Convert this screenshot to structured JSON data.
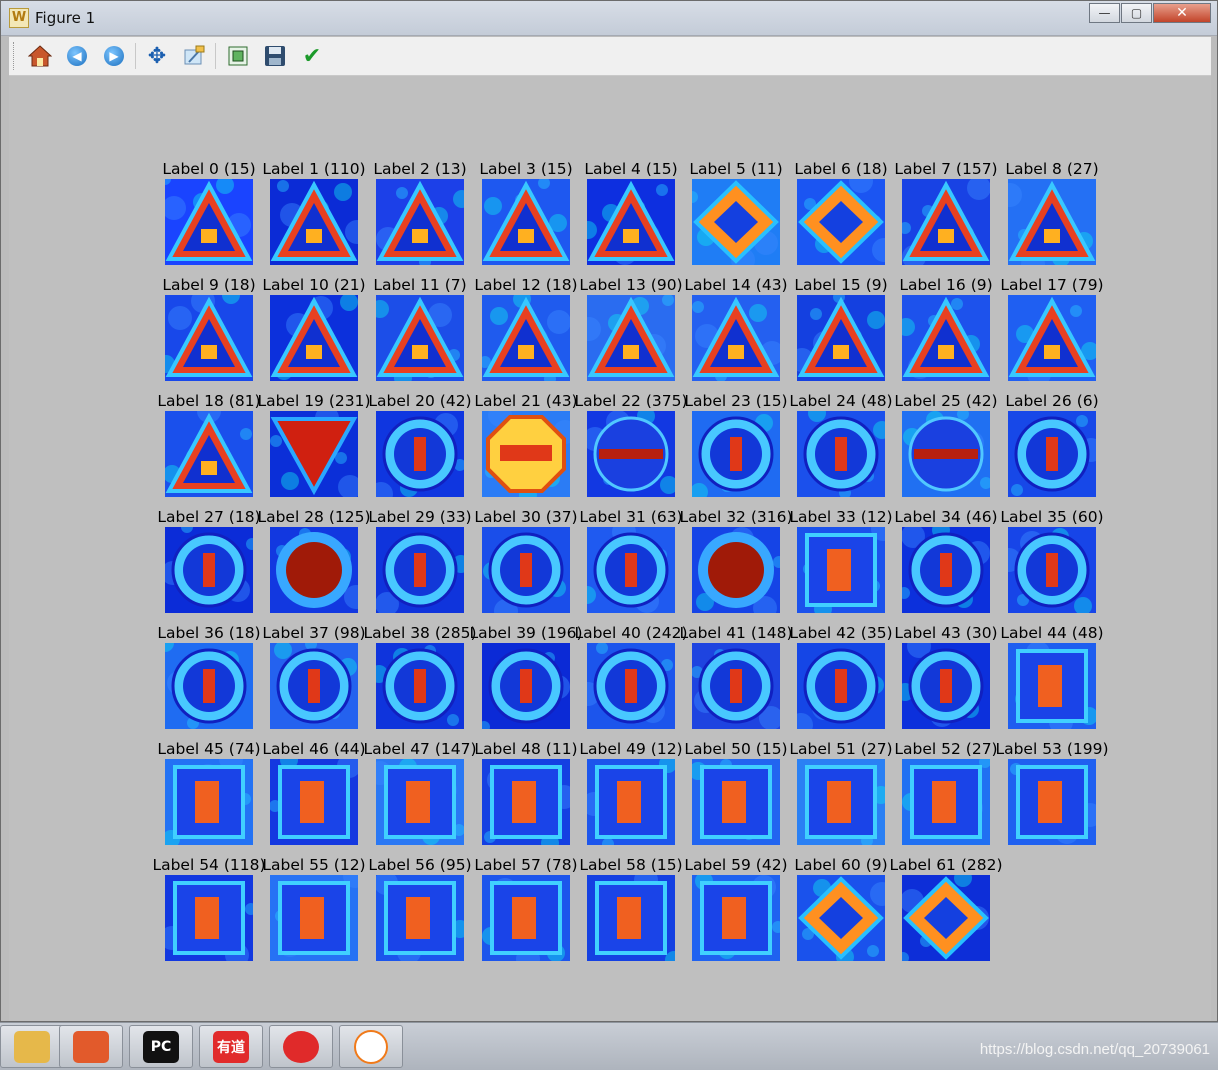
{
  "window": {
    "title": "Figure 1",
    "app_icon_glyph": "W",
    "minimize_glyph": "—",
    "maximize_glyph": "▢",
    "close_glyph": "✕"
  },
  "toolbar": {
    "buttons": [
      {
        "name": "home-icon"
      },
      {
        "name": "back-arrow-icon",
        "glyph": "◀"
      },
      {
        "name": "forward-arrow-icon",
        "glyph": "▶"
      },
      {
        "name": "pan-icon",
        "glyph": "✥"
      },
      {
        "name": "zoom-icon"
      },
      {
        "name": "subplots-config-icon"
      },
      {
        "name": "save-icon"
      },
      {
        "name": "edit-check-icon",
        "glyph": "✔"
      }
    ]
  },
  "figure": {
    "cells": [
      {
        "label": "Label 0 (15)",
        "shape": "triangle",
        "bg": "#1a44ff"
      },
      {
        "label": "Label 1 (110)",
        "shape": "triangle",
        "bg": "#0b2bd6"
      },
      {
        "label": "Label 2 (13)",
        "shape": "triangle",
        "bg": "#1c40e8"
      },
      {
        "label": "Label 3 (15)",
        "shape": "triangle",
        "bg": "#1e58f0"
      },
      {
        "label": "Label 4 (15)",
        "shape": "triangle",
        "bg": "#0d2fe0"
      },
      {
        "label": "Label 5 (11)",
        "shape": "diamond",
        "bg": "#1f7df5"
      },
      {
        "label": "Label 6 (18)",
        "shape": "diamond",
        "bg": "#1b55f2"
      },
      {
        "label": "Label 7 (157)",
        "shape": "triangle",
        "bg": "#1842e4"
      },
      {
        "label": "Label 8 (27)",
        "shape": "triangle",
        "bg": "#2470f4"
      },
      {
        "label": "Label 9 (18)",
        "shape": "triangle",
        "bg": "#1848ea"
      },
      {
        "label": "Label 10 (21)",
        "shape": "triangle",
        "bg": "#0c30dc"
      },
      {
        "label": "Label 11 (7)",
        "shape": "triangle",
        "bg": "#1c4ee8"
      },
      {
        "label": "Label 12 (18)",
        "shape": "triangle",
        "bg": "#1f5bee"
      },
      {
        "label": "Label 13 (90)",
        "shape": "triangle",
        "bg": "#2a6cf0"
      },
      {
        "label": "Label 14 (43)",
        "shape": "triangle",
        "bg": "#2460f0"
      },
      {
        "label": "Label 15 (9)",
        "shape": "triangle",
        "bg": "#1440e0"
      },
      {
        "label": "Label 16 (9)",
        "shape": "triangle",
        "bg": "#1d52ec"
      },
      {
        "label": "Label 17 (79)",
        "shape": "triangle",
        "bg": "#1f5ff2"
      },
      {
        "label": "Label 18 (81)",
        "shape": "triangle",
        "bg": "#1a50ec"
      },
      {
        "label": "Label 19 (231)",
        "shape": "inv-triangle",
        "bg": "#0b2fd8"
      },
      {
        "label": "Label 20 (42)",
        "shape": "circle",
        "bg": "#0f36e0"
      },
      {
        "label": "Label 21 (43)",
        "shape": "octagon",
        "bg": "#2b7cf5"
      },
      {
        "label": "Label 22 (375)",
        "shape": "no-entry",
        "bg": "#1238e2"
      },
      {
        "label": "Label 23 (15)",
        "shape": "circle",
        "bg": "#1f6bf2"
      },
      {
        "label": "Label 24 (48)",
        "shape": "circle",
        "bg": "#1b50ec"
      },
      {
        "label": "Label 25 (42)",
        "shape": "no-entry",
        "bg": "#2070f2"
      },
      {
        "label": "Label 26 (6)",
        "shape": "circle",
        "bg": "#1748e8"
      },
      {
        "label": "Label 27 (18)",
        "shape": "circle",
        "bg": "#0b2cd8"
      },
      {
        "label": "Label 28 (125)",
        "shape": "circle-red",
        "bg": "#1238e0"
      },
      {
        "label": "Label 29 (33)",
        "shape": "circle",
        "bg": "#0f34dc"
      },
      {
        "label": "Label 30 (37)",
        "shape": "circle",
        "bg": "#1a4eea"
      },
      {
        "label": "Label 31 (63)",
        "shape": "circle",
        "bg": "#1f5af0"
      },
      {
        "label": "Label 32 (316)",
        "shape": "circle-red",
        "bg": "#1544e6"
      },
      {
        "label": "Label 33 (12)",
        "shape": "rect",
        "bg": "#1b52ec"
      },
      {
        "label": "Label 34 (46)",
        "shape": "circle",
        "bg": "#0c30dc"
      },
      {
        "label": "Label 35 (60)",
        "shape": "circle",
        "bg": "#1745e8"
      },
      {
        "label": "Label 36 (18)",
        "shape": "circle",
        "bg": "#1f6cf2"
      },
      {
        "label": "Label 37 (98)",
        "shape": "circle",
        "bg": "#2462ef"
      },
      {
        "label": "Label 38 (285)",
        "shape": "circle",
        "bg": "#0f34dc"
      },
      {
        "label": "Label 39 (196)",
        "shape": "circle",
        "bg": "#0b2ad6"
      },
      {
        "label": "Label 40 (242)",
        "shape": "circle",
        "bg": "#1c55ec"
      },
      {
        "label": "Label 41 (148)",
        "shape": "circle",
        "bg": "#1e44e0"
      },
      {
        "label": "Label 42 (35)",
        "shape": "circle",
        "bg": "#1546e6"
      },
      {
        "label": "Label 43 (30)",
        "shape": "circle",
        "bg": "#0c30dc"
      },
      {
        "label": "Label 44 (48)",
        "shape": "rect",
        "bg": "#1e5ef0"
      },
      {
        "label": "Label 45 (74)",
        "shape": "rect",
        "bg": "#2372f4"
      },
      {
        "label": "Label 46 (44)",
        "shape": "rect",
        "bg": "#1438e0"
      },
      {
        "label": "Label 47 (147)",
        "shape": "rect",
        "bg": "#2a78f4"
      },
      {
        "label": "Label 48 (11)",
        "shape": "rect",
        "bg": "#1440e2"
      },
      {
        "label": "Label 49 (12)",
        "shape": "rect",
        "bg": "#1c55ec"
      },
      {
        "label": "Label 50 (15)",
        "shape": "rect",
        "bg": "#2265f0"
      },
      {
        "label": "Label 51 (27)",
        "shape": "rect",
        "bg": "#2a80f4"
      },
      {
        "label": "Label 52 (27)",
        "shape": "rect",
        "bg": "#2070f2"
      },
      {
        "label": "Label 53 (199)",
        "shape": "rect",
        "bg": "#1f60f0"
      },
      {
        "label": "Label 54 (118)",
        "shape": "rect",
        "bg": "#1238e0"
      },
      {
        "label": "Label 55 (12)",
        "shape": "rect",
        "bg": "#2672f4"
      },
      {
        "label": "Label 56 (95)",
        "shape": "rect",
        "bg": "#1b55ec"
      },
      {
        "label": "Label 57 (78)",
        "shape": "rect",
        "bg": "#1c55ec"
      },
      {
        "label": "Label 58 (15)",
        "shape": "rect",
        "bg": "#1440e2"
      },
      {
        "label": "Label 59 (42)",
        "shape": "rect",
        "bg": "#1f62f0"
      },
      {
        "label": "Label 60 (9)",
        "shape": "diamond",
        "bg": "#1a52ec"
      },
      {
        "label": "Label 61 (282)",
        "shape": "diamond",
        "bg": "#0d2ed8"
      }
    ]
  },
  "taskbar": {
    "items": [
      {
        "name": "file-explorer-icon",
        "color": "#e6b84a",
        "text": ""
      },
      {
        "name": "photo-app-icon",
        "color": "#e25a2b",
        "text": ""
      },
      {
        "name": "pycharm-icon",
        "color": "#111111",
        "text": "PC"
      },
      {
        "name": "youdao-icon",
        "color": "#e12b2b",
        "text": "有道"
      },
      {
        "name": "netease-music-icon",
        "color": "#e02a2a",
        "text": ""
      },
      {
        "name": "jupyter-icon",
        "color": "#ffffff",
        "text": ""
      }
    ],
    "watermark": "https://blog.csdn.net/qq_20739061"
  }
}
